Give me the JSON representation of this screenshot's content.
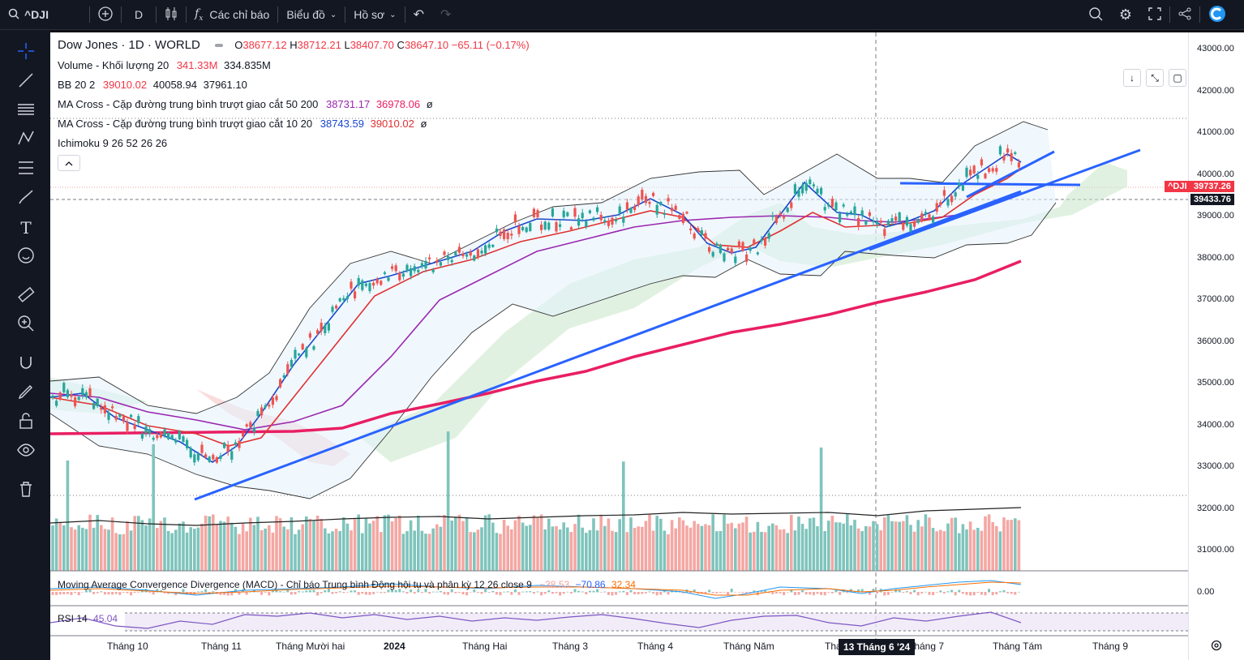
{
  "topbar": {
    "symbol": "^DJI",
    "interval": "D",
    "indicators_label": "Các chỉ báo",
    "chart_type_label": "Biểu đồ",
    "profile_label": "Hồ sơ"
  },
  "legend": {
    "title": "Dow Jones · 1D · WORLD",
    "o_label": "O",
    "o_val": "38677.12",
    "h_label": "H",
    "h_val": "38712.21",
    "l_label": "L",
    "l_val": "38407.70",
    "c_label": "C",
    "c_val": "38647.10",
    "change": "−65.11 (−0.17%)",
    "volume_label": "Volume - Khối lượng 20",
    "volume_v1": "341.33M",
    "volume_v2": "334.835M",
    "bb_label": "BB 20 2",
    "bb_v1": "39010.02",
    "bb_v2": "40058.94",
    "bb_v3": "37961.10",
    "ma1_label": "MA Cross - Cặp đường trung bình trượt giao cắt 50 200",
    "ma1_v1": "38731.17",
    "ma1_v2": "36978.06",
    "ma1_v3": "ø",
    "ma2_label": "MA Cross - Cặp đường trung bình trượt giao cắt 10 20",
    "ma2_v1": "38743.59",
    "ma2_v2": "39010.02",
    "ma2_v3": "ø",
    "ichimoku_label": "Ichimoku 9 26 52 26 26"
  },
  "macd": {
    "label": "Moving Average Convergence Divergence (MACD) - Chỉ báo Trung bình Động hội tụ và phân kỳ 12 26 close 9",
    "v1": "−38.53",
    "v2": "−70.86",
    "v3": "32.34",
    "zero": "0.00"
  },
  "rsi": {
    "label": "RSI 14",
    "value": "45.04"
  },
  "price_axis": [
    "43000.00",
    "42000.00",
    "41000.00",
    "40000.00",
    "39000.00",
    "38000.00",
    "37000.00",
    "36000.00",
    "35000.00",
    "34000.00",
    "33000.00",
    "32000.00",
    "31000.00"
  ],
  "badges": {
    "symbol": "^DJI",
    "last": "39737.26",
    "cross": "39433.76"
  },
  "time_axis": [
    "Tháng 10",
    "Tháng 11",
    "Tháng Mười hai",
    "2024",
    "Tháng Hai",
    "Tháng 3",
    "Tháng 4",
    "Tháng Năm",
    "Tha",
    "Tháng 7",
    "Tháng Tám",
    "Tháng 9"
  ],
  "crosshair_date": "13 Tháng 6 '24",
  "colors": {
    "up": "#26a69a",
    "down": "#ef5350",
    "ma_fast": "#1848cc",
    "ma_slow": "#e03131",
    "ma50": "#9c27b0",
    "ma200": "#e91e63",
    "trend": "#2962ff",
    "badge_red": "#f23645"
  }
}
